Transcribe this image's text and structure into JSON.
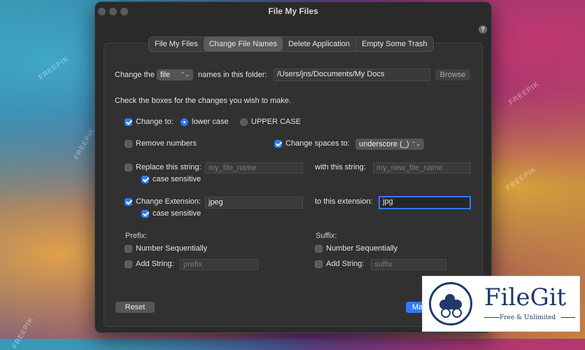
{
  "window": {
    "title": "File My Files",
    "help_label": "?"
  },
  "tabs": [
    {
      "label": "File My Files"
    },
    {
      "label": "Change File Names",
      "active": true
    },
    {
      "label": "Delete Application"
    },
    {
      "label": "Empty Some Trash"
    }
  ],
  "folder_row": {
    "prefix_label": "Change the",
    "type_value": "file",
    "suffix_label": "names in this folder:",
    "path_value": "/Users/jns/Documents/My Docs",
    "browse_label": "Browse"
  },
  "instructions": "Check the boxes for the changes you wish to make.",
  "change_to": {
    "label": "Change to:",
    "checked": true,
    "lower_label": "lower case",
    "upper_label": "UPPER CASE",
    "selected": "lower"
  },
  "remove_numbers": {
    "label": "Remove numbers",
    "checked": false
  },
  "change_spaces": {
    "label": "Change spaces to:",
    "checked": true,
    "value": "underscore (_)"
  },
  "replace_string": {
    "label": "Replace this string:",
    "checked": false,
    "find_placeholder": "my_file_name",
    "with_label": "with this string:",
    "replace_placeholder": "my_new_file_name",
    "case_label": "case sensitive",
    "case_checked": true
  },
  "change_extension": {
    "label": "Change Extension:",
    "checked": true,
    "from_value": "jpeg",
    "to_label": "to this extension:",
    "to_value": "jpg",
    "case_label": "case sensitive",
    "case_checked": true
  },
  "prefix": {
    "heading": "Prefix:",
    "number_label": "Number Sequentially",
    "number_checked": false,
    "add_label": "Add String:",
    "add_checked": false,
    "add_placeholder": "prefix"
  },
  "suffix": {
    "heading": "Suffix:",
    "number_label": "Number Sequentially",
    "number_checked": false,
    "add_label": "Add String:",
    "add_checked": false,
    "add_placeholder": "suffix"
  },
  "buttons": {
    "reset_label": "Reset",
    "primary_label": "Ma"
  },
  "watermarks": [
    "FREEPIK",
    "FREEPIK",
    "FREEPIK",
    "FREEPIK",
    "FREEPIK"
  ],
  "overlay_logo": {
    "name": "FileGit",
    "tagline": "Free & Unlimited"
  },
  "colors": {
    "accent": "#2f7cf6",
    "window_bg": "#2a2a2a",
    "logo_navy": "#1f3a6b"
  }
}
